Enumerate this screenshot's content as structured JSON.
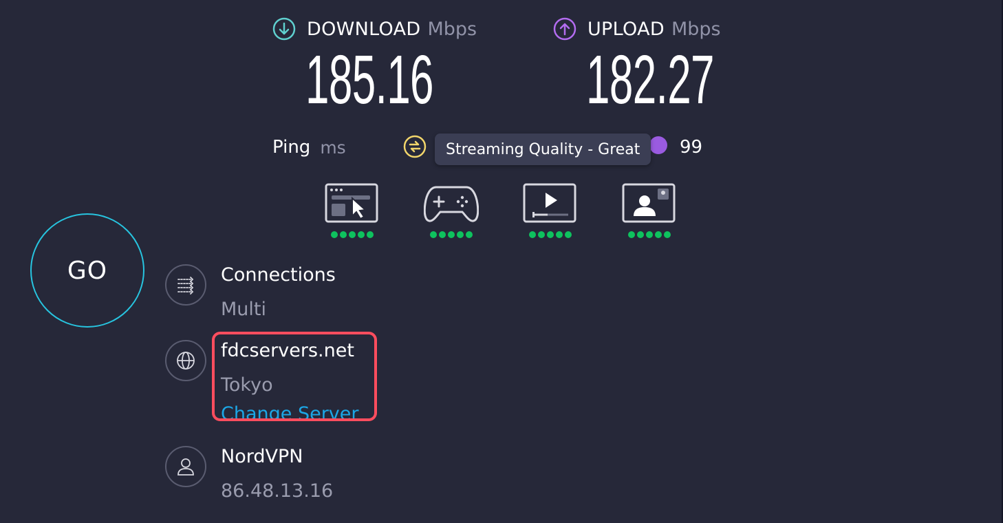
{
  "download": {
    "label": "DOWNLOAD",
    "unit": "Mbps",
    "value": "185.16"
  },
  "upload": {
    "label": "UPLOAD",
    "unit": "Mbps",
    "value": "182.27"
  },
  "ping": {
    "label": "Ping",
    "unit": "ms",
    "value_right": "99"
  },
  "tooltip": {
    "text": "Streaming Quality - Great"
  },
  "quality": [
    {
      "name": "web-browsing",
      "icon": "browser-cursor-icon",
      "rating": 5
    },
    {
      "name": "gaming",
      "icon": "gamepad-icon",
      "rating": 5
    },
    {
      "name": "streaming",
      "icon": "video-play-icon",
      "rating": 5
    },
    {
      "name": "video-chat",
      "icon": "video-call-icon",
      "rating": 5
    }
  ],
  "go": {
    "label": "GO"
  },
  "connections": {
    "title": "Connections",
    "value": "Multi",
    "icon": "connections-icon"
  },
  "server": {
    "name": "fdcservers.net",
    "location": "Tokyo",
    "change_label": "Change Server",
    "icon": "globe-icon"
  },
  "provider": {
    "name": "NordVPN",
    "ip": "86.48.13.16",
    "icon": "user-icon"
  },
  "colors": {
    "background": "#262839",
    "download_accent": "#5fd0cf",
    "upload_accent": "#b36cf0",
    "go_ring": "#27c5e0",
    "link": "#1ca7e6",
    "rating_dot": "#0ec25e",
    "highlight": "#ff4d5e"
  }
}
